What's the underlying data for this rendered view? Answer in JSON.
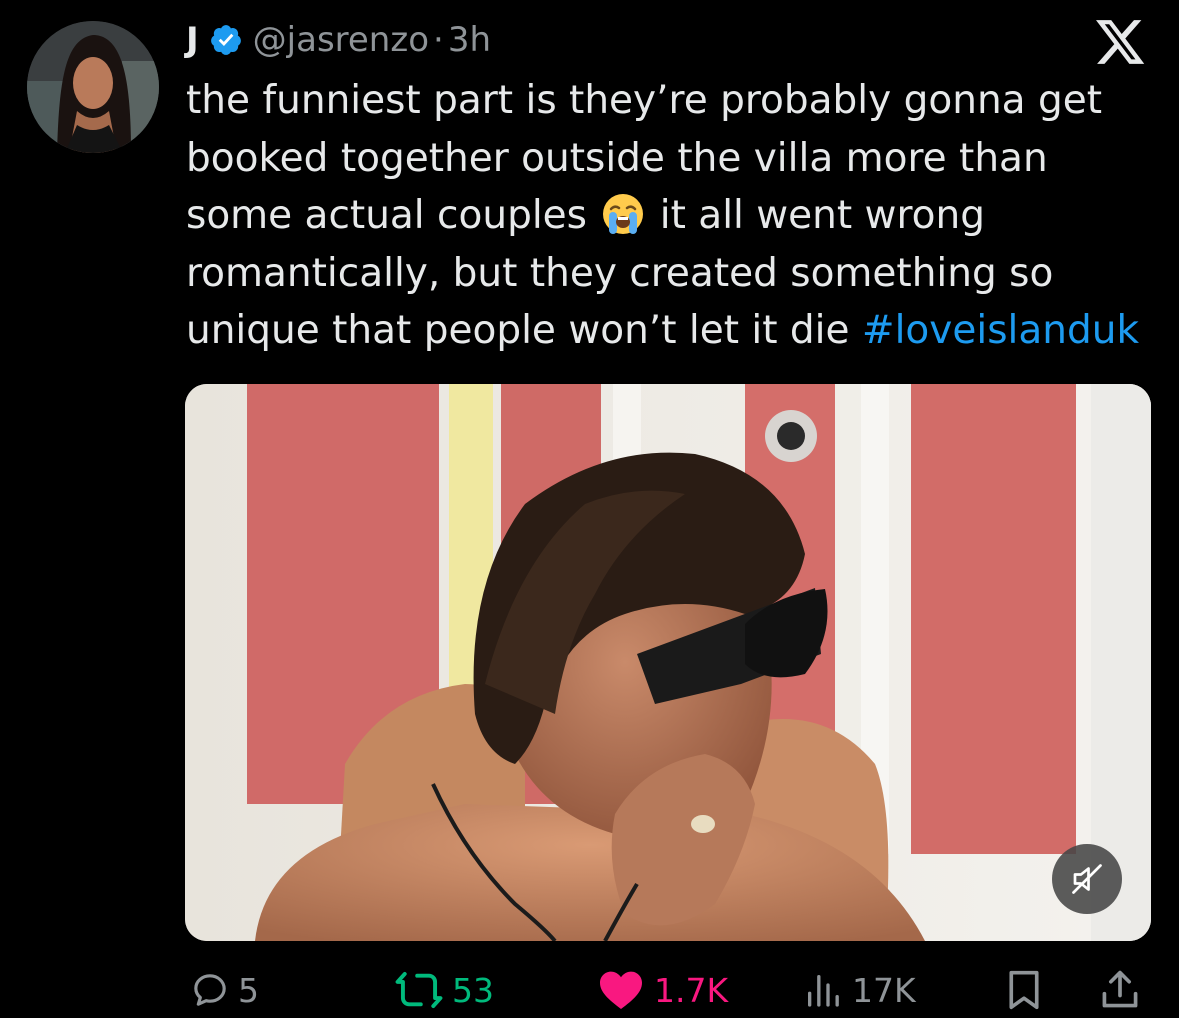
{
  "tweet": {
    "display_name": "J",
    "handle": "@jasrenzo",
    "separator": "·",
    "time": "3h",
    "text_part1": "the funniest part is they’re probably gonna get\nbooked together outside the villa more than\nsome actual couples ",
    "emoji": "crying-face",
    "text_part2": " it all went wrong\nromantically, but they created something so\nunique that people won’t let it die ",
    "hashtag": "#loveislanduk"
  },
  "actions": {
    "replies": "5",
    "retweets": "53",
    "likes": "1.7K",
    "views": "17K"
  },
  "colors": {
    "background": "#000000",
    "text": "#e7e9ea",
    "secondary": "#8f9498",
    "link": "#1d9bf0",
    "retweet": "#00ba7c",
    "like": "#f91880",
    "verified": "#1d9bf0"
  },
  "icons": [
    "verified-badge-icon",
    "x-logo-icon",
    "reply-icon",
    "retweet-icon",
    "like-heart-icon",
    "views-icon",
    "bookmark-icon",
    "share-icon",
    "mute-icon"
  ]
}
